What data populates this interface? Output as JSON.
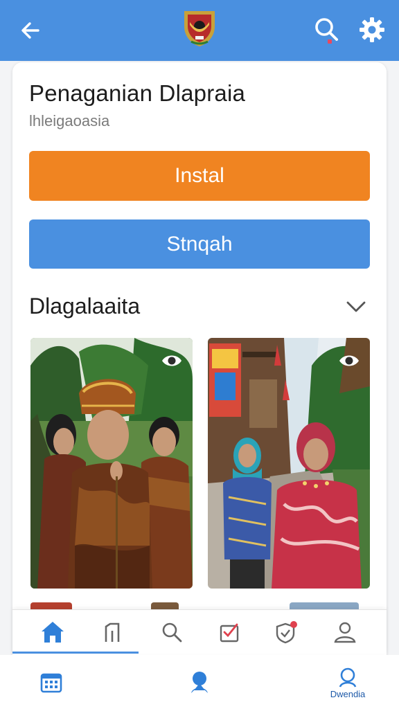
{
  "header": {
    "back_icon": "arrow-left-icon",
    "logo": "garuda-emblem-logo",
    "search_icon": "search-icon",
    "settings_icon": "gear-icon",
    "color": "#4a90e0"
  },
  "app": {
    "title": "Penaganian Dlapraia",
    "subtitle": "lhleigaoasia"
  },
  "actions": {
    "install_label": "Instal",
    "secondary_label": "Stnqah",
    "install_color": "#f08421",
    "secondary_color": "#4a90e0"
  },
  "gallery": {
    "title": "Dlagalaaita",
    "expand_icon": "chevron-down-icon",
    "photos": [
      {
        "description_icon": "eye-icon"
      },
      {
        "description_icon": "eye-icon"
      }
    ]
  },
  "tabs": [
    {
      "icon": "home-icon",
      "active": true
    },
    {
      "icon": "building-icon",
      "active": false
    },
    {
      "icon": "search-icon",
      "active": false
    },
    {
      "icon": "checklist-icon",
      "active": false
    },
    {
      "icon": "shield-badge-icon",
      "active": false
    },
    {
      "icon": "user-icon",
      "active": false
    }
  ],
  "bottom_nav": [
    {
      "icon": "calendar-grid-icon",
      "label": ""
    },
    {
      "icon": "location-person-icon",
      "label": ""
    },
    {
      "icon": "profile-search-icon",
      "label": "Dwendia"
    }
  ]
}
